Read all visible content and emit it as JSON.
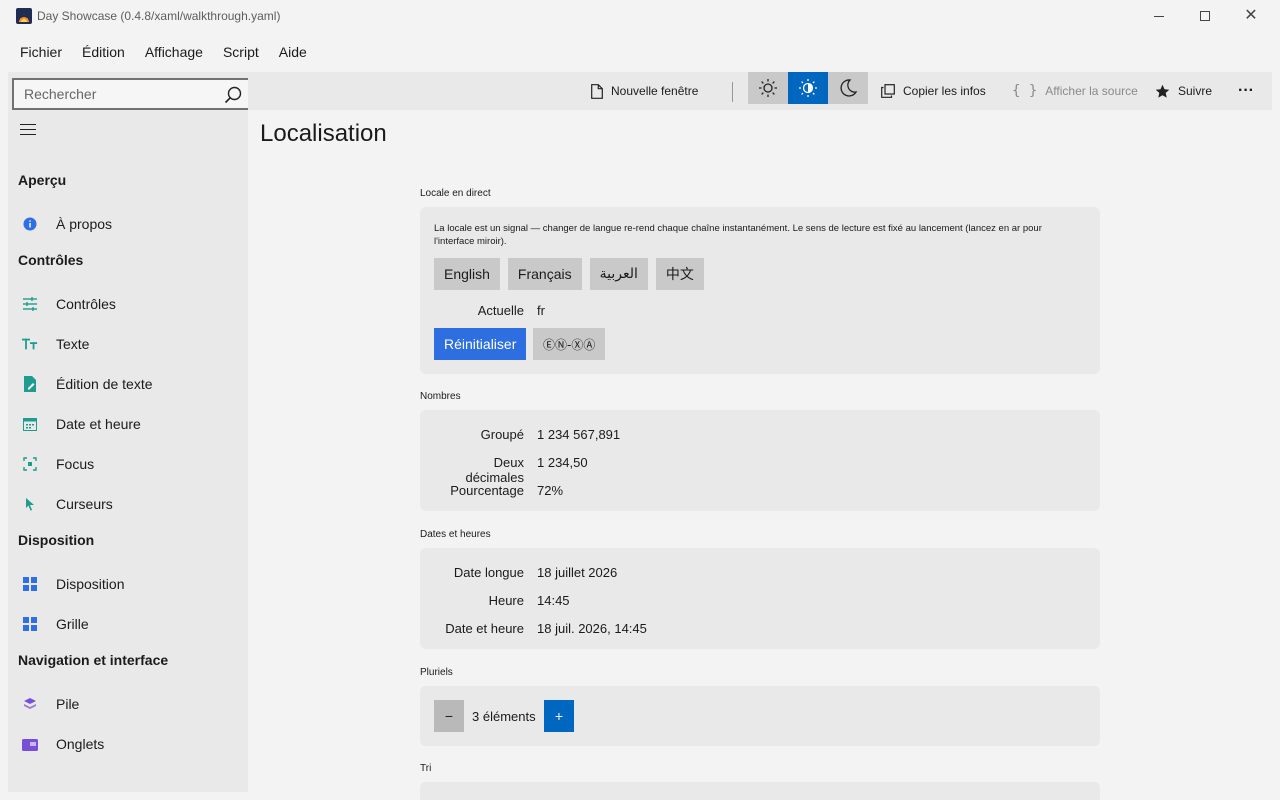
{
  "window": {
    "title": "Day Showcase (0.4.8/xaml/walkthrough.yaml)",
    "close_glyph": "✕"
  },
  "menu": [
    "Fichier",
    "Édition",
    "Affichage",
    "Script",
    "Aide"
  ],
  "search": {
    "placeholder": "Rechercher"
  },
  "sidebar": {
    "groups": [
      {
        "header": "Aperçu",
        "items": [
          {
            "label": "À propos",
            "icon": "info-icon"
          }
        ]
      },
      {
        "header": "Contrôles",
        "items": [
          {
            "label": "Contrôles",
            "icon": "sliders-icon"
          },
          {
            "label": "Texte",
            "icon": "text-icon"
          },
          {
            "label": "Édition de texte",
            "icon": "edit-document-icon"
          },
          {
            "label": "Date et heure",
            "icon": "calendar-icon"
          },
          {
            "label": "Focus",
            "icon": "focus-icon"
          },
          {
            "label": "Curseurs",
            "icon": "cursor-icon"
          }
        ]
      },
      {
        "header": "Disposition",
        "items": [
          {
            "label": "Disposition",
            "icon": "layout-grid-icon"
          },
          {
            "label": "Grille",
            "icon": "grid-icon"
          }
        ]
      },
      {
        "header": "Navigation et interface",
        "items": [
          {
            "label": "Pile",
            "icon": "stack-icon"
          },
          {
            "label": "Onglets",
            "icon": "tabs-icon"
          }
        ]
      }
    ]
  },
  "toolbar": {
    "new_window": "Nouvelle fenêtre",
    "copy_info": "Copier les infos",
    "show_source": "Afficher la source",
    "follow": "Suivre",
    "more": "···",
    "theme_active": "auto",
    "colors": {
      "accent": "#0067c0",
      "theme_bg": "#c9c9c9"
    }
  },
  "page": {
    "title": "Localisation",
    "live_locale": {
      "label": "Locale en direct",
      "description": "La locale est un signal — changer de langue re-rend chaque chaîne instantanément. Le sens de lecture est fixé au lancement (lancez en ar pour l'interface miroir).",
      "languages": [
        "English",
        "Français",
        "العربية",
        "中文"
      ],
      "current_label": "Actuelle",
      "current_value": "fr",
      "reset": "Réinitialiser",
      "pseudo": "ⒺⓃ-ⓍⒶ"
    },
    "numbers": {
      "label": "Nombres",
      "rows": [
        {
          "k": "Groupé",
          "v": "1 234 567,891"
        },
        {
          "k": "Deux décimales",
          "v": "1 234,50"
        },
        {
          "k": "Pourcentage",
          "v": "72%"
        }
      ]
    },
    "dates": {
      "label": "Dates et heures",
      "rows": [
        {
          "k": "Date longue",
          "v": "18 juillet 2026"
        },
        {
          "k": "Heure",
          "v": "14:45"
        },
        {
          "k": "Date et heure",
          "v": "18 juil. 2026, 14:45"
        }
      ]
    },
    "plurals": {
      "label": "Pluriels",
      "minus": "−",
      "value": "3 éléments",
      "plus": "+"
    },
    "sort": {
      "label": "Tri"
    }
  }
}
